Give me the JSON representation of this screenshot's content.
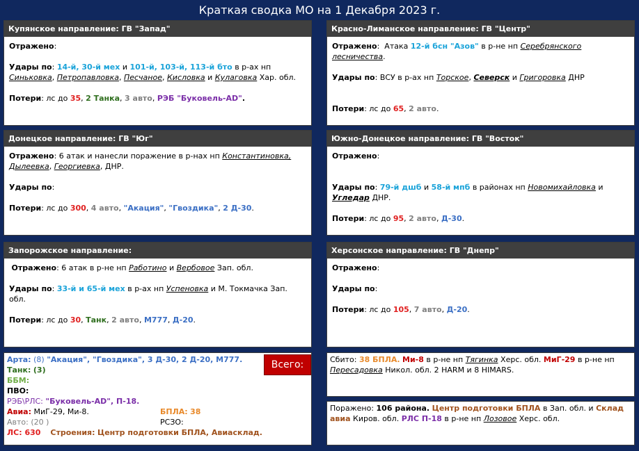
{
  "title": "Краткая сводка МО на 1 Декабря 2023 г.",
  "labels": {
    "repelled": "Отражено",
    "strikes": "Удары по",
    "losses": "Потери",
    "total": "Всего:"
  },
  "kupyansk": {
    "header": "Купянское направление: ГВ \"Запад\"",
    "strikes_units": "14-й, 30-й мех",
    "and1": "и",
    "strikes_units2": "101-й, 103-й, 113-й бто",
    "in_area": "в р-ах нп",
    "places": [
      "Синьковка",
      "Петропавловка",
      "Песчаное",
      "Кисловка",
      "Кулаговка"
    ],
    "region": "Хар. обл.",
    "losses_prefix": "лс до",
    "ls": "35",
    "tanks": "2 Танка",
    "auto": "3 авто",
    "reb": "РЭБ \"Буковель-AD\""
  },
  "krasno": {
    "header": "Красно-Лиманское направление: ГВ \"Центр\"",
    "repelled_prefix": "Атака",
    "unit": "12-й бсн \"Азов\"",
    "repelled_mid": "в р-не нп",
    "place": "Серебрянского лесничества",
    "strikes_text": "ВСУ в р-ах нп",
    "places": [
      "Торское",
      "Северск",
      "Григоровка"
    ],
    "and": "и",
    "region": "ДНР",
    "losses_prefix": "лс до",
    "ls": "65",
    "auto": "2 авто"
  },
  "donetsk": {
    "header": "Донецкое направление: ГВ \"Юг\"",
    "repelled_text": "6 атак  и нанесли поражение в р-нах нп",
    "places": [
      "Константиновка,",
      "Дылеевка",
      "Георгиевка"
    ],
    "region": "ДНР.",
    "losses_prefix": "лс до",
    "ls": "300",
    "auto": "4 авто",
    "akacia": "\"Акация\"",
    "gvozdika": "\"Гвоздика\"",
    "d30": "2 Д-30"
  },
  "south_donetsk": {
    "header": "Южно-Донецкое направление: ГВ \"Восток\"",
    "unit1": "79-й дшб",
    "and": "и",
    "unit2": "58-й мпб",
    "in_area": "в районах нп",
    "place1": "Новомихайловка",
    "place2": "Угледар",
    "region": "ДНР.",
    "losses_prefix": "лс до",
    "ls": "95",
    "auto": "2 авто",
    "d30": "Д-30"
  },
  "zaporozhye": {
    "header": "Запорожское направление:",
    "repelled_text": "6 атак в р-не нп",
    "place1": "Работино",
    "and": "и",
    "place2": "Вербовое",
    "region": "Зап. обл.",
    "units": "33-й и 65-й мех",
    "in_area": "в р-ах нп",
    "place3": "Успеновка",
    "strikes_tail": "и М. Токмачка Зап. обл.",
    "losses_prefix": "лс до",
    "ls": "30",
    "tank": "Танк",
    "auto": "2 авто",
    "m777": "М777",
    "d20": "Д-20"
  },
  "kherson": {
    "header": "Херсонское направление: ГВ \"Днепр\"",
    "losses_prefix": "лс до",
    "ls": "105",
    "auto": "7 авто",
    "d20": "Д-20"
  },
  "totals": {
    "arta_label": "Арта:",
    "arta_count": "(8)",
    "arta_items": "\"Акация\", \"Гвоздика\", 3 Д-30, 2 Д-20, М777.",
    "tank_label": "Танк:",
    "tank_count": "(3)",
    "bbm_label": "ББМ:",
    "pvo_label": "ПВО:",
    "reb_label": "РЭБ\\РЛС:",
    "reb_items": "\"Буковель-AD\",  П-18.",
    "avia_label": "Авиа:",
    "avia_items": "МиГ-29, Ми-8.",
    "bpla_label": "БПЛА:",
    "bpla_count": "38",
    "auto_label": "Авто:",
    "auto_count": "(20 )",
    "rszo_label": "РСЗО:",
    "ls_label": "ЛС: 630",
    "buildings_label": "Строения:",
    "buildings_items": "Центр подготовки БПЛА, Авиасклад."
  },
  "downed": {
    "label": "Сбито:",
    "bpla": "38 БПЛА.",
    "mi8": "Ми-8",
    "in_area": "в р-не нп",
    "place1": "Тягинка",
    "region1": "Херс. обл.",
    "mig": "МиГ-29",
    "place2": "Пересадовка",
    "region2": "Никол. обл. 2 HARM и 8 HIMARS."
  },
  "hit": {
    "label": "Поражено:",
    "districts": "106 района",
    "center": "Центр подготовки БПЛА",
    "in_region": "в Зап. обл. и",
    "warehouse": "Склад авиа",
    "region2": "Киров. обл.",
    "rls": "РЛС П-18",
    "in_area": "в р-не нп",
    "place": "Лозовое",
    "region3": "Херс. обл."
  },
  "colors": {
    "background": "#10285e",
    "header": "#3f3f3f",
    "cyan": "#1aa3d9",
    "red": "#e02020",
    "total_box": "#c00000"
  }
}
